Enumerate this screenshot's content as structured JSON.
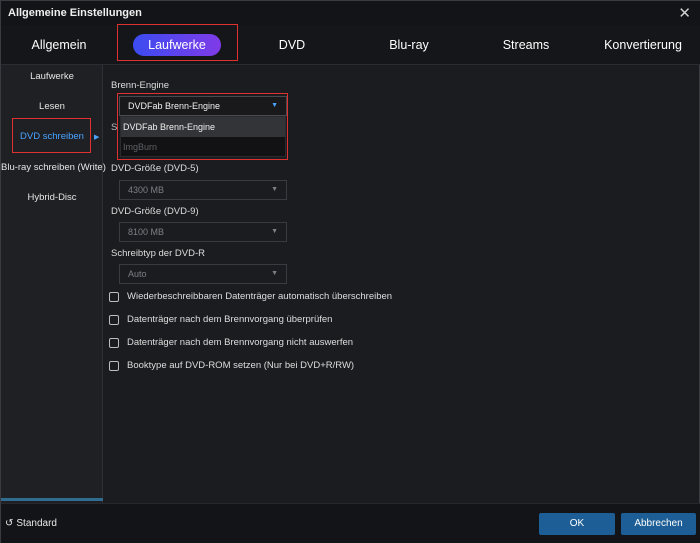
{
  "window": {
    "title": "Allgemeine Einstellungen",
    "close_glyph": "✕"
  },
  "tabs": [
    {
      "label": "Allgemein"
    },
    {
      "label": "Laufwerke",
      "active": true
    },
    {
      "label": "DVD"
    },
    {
      "label": "Blu-ray"
    },
    {
      "label": "Streams"
    },
    {
      "label": "Konvertierung"
    }
  ],
  "sidebar": {
    "items": [
      {
        "label": "Laufwerke"
      },
      {
        "label": "Lesen"
      },
      {
        "label": "DVD schreiben",
        "active": true
      },
      {
        "label": "Blu-ray schreiben (Write)"
      },
      {
        "label": "Hybrid-Disc"
      }
    ],
    "arrow_glyph": "▶"
  },
  "content": {
    "burn_engine": {
      "label": "Brenn-Engine",
      "value": "DVDFab Brenn-Engine",
      "options": [
        "DVDFab Brenn-Engine",
        "ImgBurn"
      ],
      "hidden_label_peek": "S"
    },
    "dvd5": {
      "label": "DVD-Größe (DVD-5)",
      "value": "4300 MB"
    },
    "dvd9": {
      "label": "DVD-Größe (DVD-9)",
      "value": "8100 MB"
    },
    "write_type": {
      "label": "Schreibtyp der DVD-R",
      "value": "Auto"
    },
    "checkboxes": [
      {
        "label": "Wiederbeschreibbaren Datenträger automatisch überschreiben",
        "checked": false
      },
      {
        "label": "Datenträger nach dem Brennvorgang überprüfen",
        "checked": false
      },
      {
        "label": "Datenträger nach dem Brennvorgang nicht auswerfen",
        "checked": false
      },
      {
        "label": "Booktype auf DVD-ROM setzen (Nur bei DVD+R/RW)",
        "checked": false
      }
    ],
    "caret_glyph": "▼"
  },
  "footer": {
    "standard_label": "Standard",
    "reset_glyph": "↺",
    "ok_label": "OK",
    "cancel_label": "Abbrechen"
  },
  "colors": {
    "accent": "#4aa3ff",
    "button": "#1c5e95",
    "highlight": "#e03131",
    "tab_gradient_start": "#3b4cf0",
    "tab_gradient_end": "#7f3be8"
  }
}
